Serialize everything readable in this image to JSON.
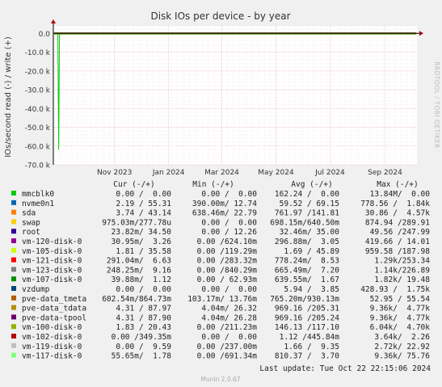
{
  "chart_data": {
    "type": "line",
    "title": "Disk IOs per device - by year",
    "ylabel": "IOs/second read (-) / write (+)",
    "side_label": "RRDTOOL / TOBI OETIKER",
    "ylim": [
      -70,
      4
    ],
    "yticks": [
      0,
      -10,
      -20,
      -30,
      -40,
      -50,
      -60,
      -70
    ],
    "ytick_labels": [
      "0.0",
      "-10.0 k",
      "-20.0 k",
      "-30.0 k",
      "-40.0 k",
      "-50.0 k",
      "-60.0 k",
      "-70.0 k"
    ],
    "x_range_days": [
      0,
      410
    ],
    "xticks": [
      {
        "label": "Nov 2023",
        "day": 69
      },
      {
        "label": "Jan 2024",
        "day": 130
      },
      {
        "label": "Mar 2024",
        "day": 190
      },
      {
        "label": "May 2024",
        "day": 251
      },
      {
        "label": "Jul 2024",
        "day": 312
      },
      {
        "label": "Sep 2024",
        "day": 374
      }
    ],
    "grid": true,
    "legend_header": [
      "Cur (-/+)",
      "Min (-/+)",
      "Avg (-/+)",
      "Max (-/+)"
    ],
    "series": [
      {
        "name": "mmcblk0",
        "color": "#00cc00",
        "cur": "0.00 /  0.00",
        "min": "0.00 /  0.00",
        "avg": "162.24 /  0.00",
        "max": "13.84M/  0.00"
      },
      {
        "name": "nvme0n1",
        "color": "#0066b3",
        "cur": "2.19 / 55.31",
        "min": "390.00m/ 12.74",
        "avg": "59.52 / 69.15",
        "max": "778.56 /  1.84k"
      },
      {
        "name": "sda",
        "color": "#ff8000",
        "cur": "3.74 / 43.14",
        "min": "638.46m/ 22.79",
        "avg": "761.97 /141.81",
        "max": "30.86 /  4.57k"
      },
      {
        "name": "swap",
        "color": "#ffcc00",
        "cur": "975.03m/277.78u",
        "min": "0.00 /  0.00",
        "avg": "698.15m/640.50m",
        "max": "874.94 /289.91"
      },
      {
        "name": "root",
        "color": "#330099",
        "cur": "23.82m/ 34.50",
        "min": "0.00 / 12.26",
        "avg": "32.46m/ 35.00",
        "max": "49.56 /247.99"
      },
      {
        "name": "vm-120-disk-0",
        "color": "#990099",
        "cur": "30.95m/  3.26",
        "min": "0.00 /624.10m",
        "avg": "296.88m/  3.05",
        "max": "419.66 / 14.01"
      },
      {
        "name": "vm-105-disk-0",
        "color": "#ccff00",
        "cur": "1.81 / 35.58",
        "min": "0.00 /119.29m",
        "avg": "1.69 / 45.89",
        "max": "959.58 /187.98"
      },
      {
        "name": "vm-121-disk-0",
        "color": "#ff0000",
        "cur": "291.04m/  6.63",
        "min": "0.00 /283.32m",
        "avg": "778.24m/  8.53",
        "max": "1.29k/253.34"
      },
      {
        "name": "vm-123-disk-0",
        "color": "#808080",
        "cur": "248.25m/  9.16",
        "min": "0.00 /840.29m",
        "avg": "665.49m/  7.20",
        "max": "1.14k/226.89"
      },
      {
        "name": "vm-107-disk-0",
        "color": "#008f00",
        "cur": "39.88m/  1.12",
        "min": "0.00 / 62.93m",
        "avg": "639.55m/  1.67",
        "max": "1.82k/ 19.48"
      },
      {
        "name": "vzdump",
        "color": "#00487d",
        "cur": "0.00 /  0.00",
        "min": "0.00 /  0.00",
        "avg": "5.94 /  3.85",
        "max": "428.93 /  1.75k"
      },
      {
        "name": "pve-data_tmeta",
        "color": "#b35a00",
        "cur": "602.54m/864.73m",
        "min": "103.17m/ 13.76m",
        "avg": "765.20m/930.13m",
        "max": "52.95 / 55.54"
      },
      {
        "name": "pve-data_tdata",
        "color": "#b38f00",
        "cur": "4.31 / 87.97",
        "min": "4.04m/ 26.32",
        "avg": "969.16 /205.31",
        "max": "9.36k/  4.77k"
      },
      {
        "name": "pve-data-tpool",
        "color": "#6b006b",
        "cur": "4.31 / 87.90",
        "min": "4.04m/ 26.28",
        "avg": "969.16 /205.24",
        "max": "9.36k/  4.77k"
      },
      {
        "name": "vm-100-disk-0",
        "color": "#8fb300",
        "cur": "1.83 / 20.43",
        "min": "0.00 /211.23m",
        "avg": "146.13 /117.10",
        "max": "6.04k/  4.70k"
      },
      {
        "name": "vm-102-disk-0",
        "color": "#b30000",
        "cur": "0.00 /349.35m",
        "min": "0.00 /  0.00",
        "avg": "1.12 /445.84m",
        "max": "3.64k/  2.26"
      },
      {
        "name": "vm-119-disk-0",
        "color": "#bebebe",
        "cur": "0.00 /  9.59",
        "min": "0.00 /237.00m",
        "avg": "1.66 /  9.35",
        "max": "2.72k/ 22.92"
      },
      {
        "name": "vm-117-disk-0",
        "color": "#80ff80",
        "cur": "55.65m/  1.78",
        "min": "0.00 /691.34m",
        "avg": "810.37 /  3.70",
        "max": "9.36k/ 75.76"
      }
    ],
    "spike": {
      "series": "mmcblk0",
      "day": 6,
      "value": -62
    },
    "last_update": "Last update: Tue Oct 22 22:15:06 2024",
    "footer": "Munin 2.0.67"
  }
}
